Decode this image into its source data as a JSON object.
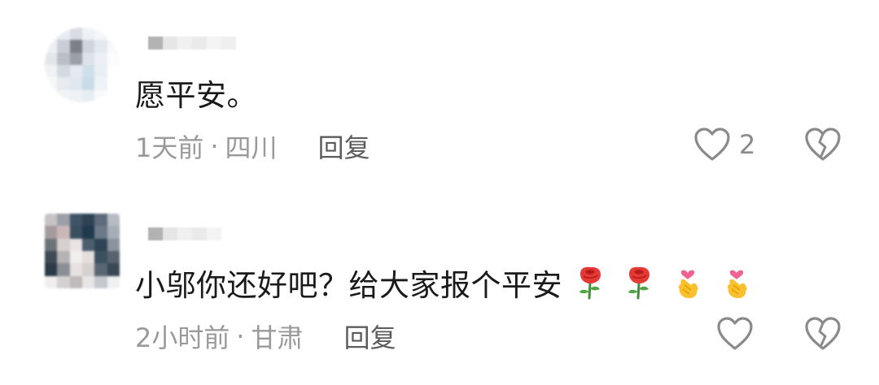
{
  "comments": [
    {
      "text": "愿平安。",
      "time": "1天前",
      "separator": "·",
      "location": "四川",
      "reply_label": "回复",
      "like_count": "2",
      "emojis": []
    },
    {
      "text": "小邬你还好吧？给大家报个平安",
      "time": "2小时前",
      "separator": "·",
      "location": "甘肃",
      "reply_label": "回复",
      "like_count": "",
      "emojis": [
        "rose-icon",
        "rose-icon",
        "finger-heart-icon",
        "finger-heart-icon"
      ]
    }
  ],
  "colors": {
    "text": "#1a1a1a",
    "meta": "#9a9a9a",
    "reply": "#5c5c5c",
    "icon": "#8a8a8a"
  }
}
